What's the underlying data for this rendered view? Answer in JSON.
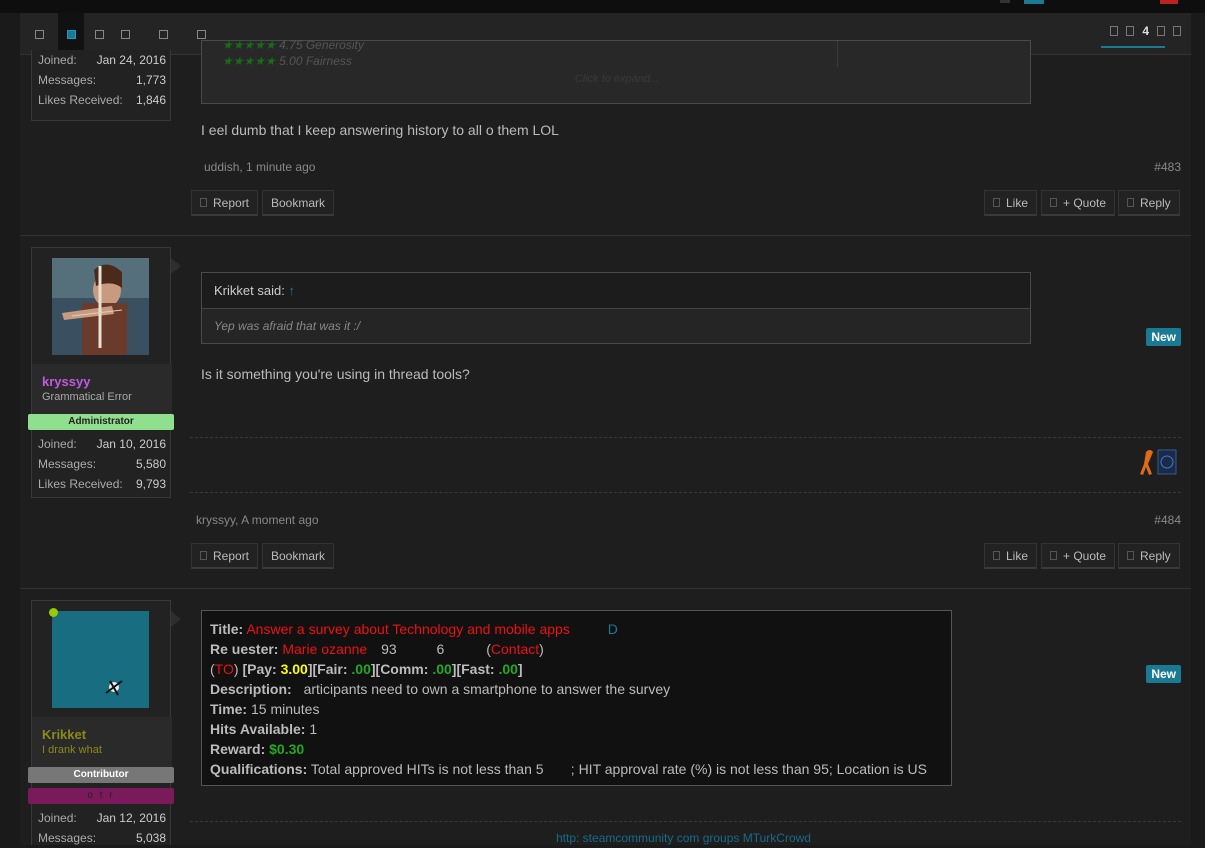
{
  "nav": {
    "page_number": "4"
  },
  "post483": {
    "user": {
      "joined_label": "Joined:",
      "joined_value": "Jan 24, 2016",
      "messages_label": "Messages:",
      "messages_value": "1,773",
      "likes_label": "Likes Received:",
      "likes_value": "1,846"
    },
    "quote": {
      "rating1": "4.75 Generosity",
      "rating2": "5.00 Fairness",
      "click_to_expand": "Click to expand..."
    },
    "message": "I  eel dumb that I keep answering history to all o  them LOL",
    "meta": "uddish, 1 minute ago",
    "number": "#483",
    "buttons": {
      "report": "Report",
      "bookmark": "Bookmark",
      "like": "Like",
      "quote": "+ Quote",
      "reply": "Reply"
    }
  },
  "post484": {
    "user": {
      "name": "kryssyy",
      "title": "Grammatical Error",
      "banner": "Administrator",
      "joined_label": "Joined:",
      "joined_value": "Jan 10, 2016",
      "messages_label": "Messages:",
      "messages_value": "5,580",
      "likes_label": "Likes Received:",
      "likes_value": "9,793"
    },
    "new_badge": "New",
    "quote": {
      "author": "Krikket said:",
      "arrow": "↑",
      "text": "Yep  was afraid that was it :/"
    },
    "message": "Is it something you're using in thread tools?",
    "meta": "kryssyy, A moment ago",
    "number": "#484",
    "buttons": {
      "report": "Report",
      "bookmark": "Bookmark",
      "like": "Like",
      "quote": "+ Quote",
      "reply": "Reply"
    }
  },
  "post485": {
    "user": {
      "name": "Krikket",
      "title": "I drank what",
      "banner": "Contributor",
      "banner2": "o t r",
      "joined_label": "Joined:",
      "joined_value": "Jan 12, 2016",
      "messages_label": "Messages:",
      "messages_value": "5,038"
    },
    "new_badge": "New",
    "hit": {
      "title_label": "Title:",
      "title_value": "Answer a survey about Technology and mobile apps",
      "title_extra": "D",
      "requester_label": "Re  uester:",
      "requester_name": "Marie ozanne",
      "requester_id1": "93",
      "requester_id2": "6",
      "contact": "Contact",
      "to": "TO",
      "pay_label": "Pay:",
      "pay_value": "3.00",
      "fair_label": "Fair:",
      "fair_value": ".00",
      "comm_label": "Comm:",
      "comm_value": ".00",
      "fast_label": "Fast:",
      "fast_value": ".00",
      "description_label": "Description:",
      "description_value": "articipants need to own a smartphone to answer the survey",
      "time_label": "Time:",
      "time_value": "15 minutes",
      "hits_label": "Hits Available:",
      "hits_value": "1",
      "reward_label": "Reward:",
      "reward_value": "$0.30",
      "quals_label": "Qualifications:",
      "quals_value": "Total approved HITs is not less than 5       ; HIT approval rate (%) is not less than 95; Location is US"
    },
    "signature_link": "http:  steamcommunity com groups MTurkCrowd"
  }
}
